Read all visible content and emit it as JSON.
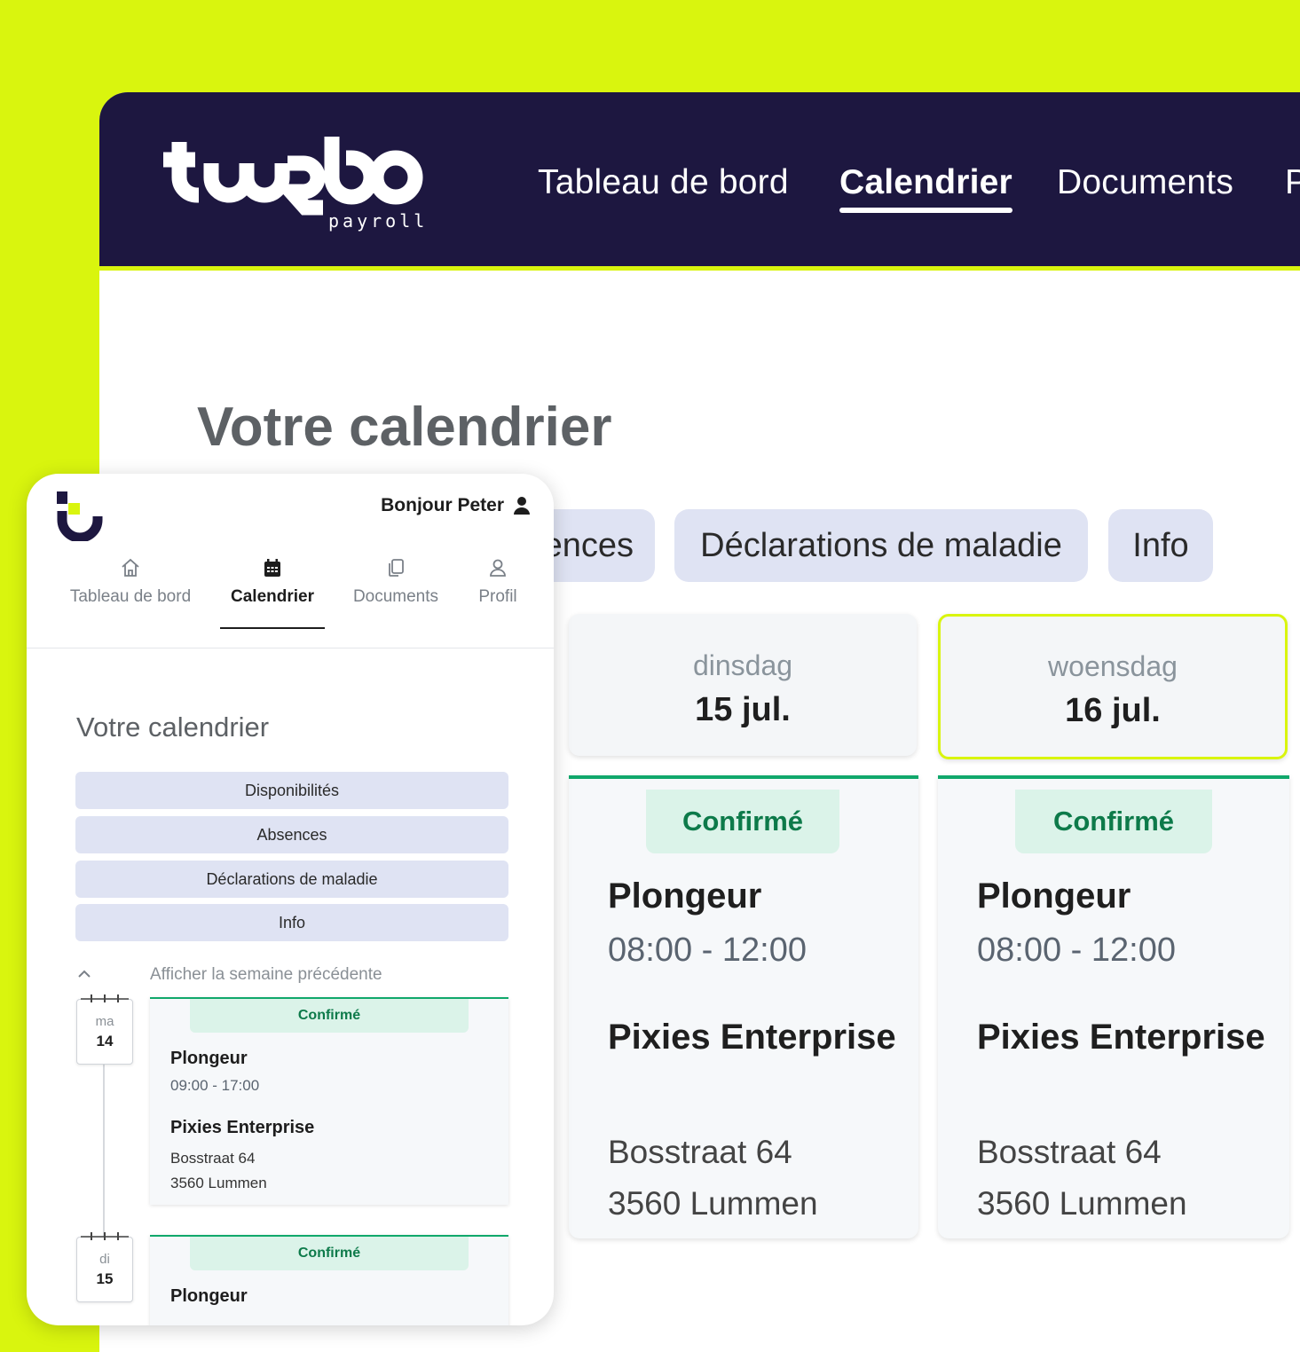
{
  "desktop": {
    "nav": {
      "logo_text": "turbo payroll",
      "items": [
        {
          "label": "Tableau de bord"
        },
        {
          "label": "Calendrier"
        },
        {
          "label": "Documents"
        },
        {
          "label": "P"
        }
      ],
      "active_index": 1
    },
    "page_title": "Votre calendrier",
    "filters": [
      {
        "label": "ences"
      },
      {
        "label": "Déclarations de maladie"
      },
      {
        "label": "Info"
      }
    ],
    "days": [
      {
        "day_name": "dinsdag",
        "date": "15 jul.",
        "today": false,
        "shift": {
          "status": "Confirmé",
          "role": "Plongeur",
          "time": "08:00 - 12:00",
          "company": "Pixies Enterprise",
          "address_line1": "Bosstraat 64",
          "address_line2": "3560 Lummen"
        }
      },
      {
        "day_name": "woensdag",
        "date": "16 jul.",
        "today": true,
        "shift": {
          "status": "Confirmé",
          "role": "Plongeur",
          "time": "08:00 - 12:00",
          "company": "Pixies Enterprise",
          "address_line1": "Bosstraat 64",
          "address_line2": "3560 Lummen"
        }
      }
    ]
  },
  "mobile": {
    "greeting": "Bonjour Peter",
    "tabs": [
      {
        "label": "Tableau de bord",
        "icon": "home-icon"
      },
      {
        "label": "Calendrier",
        "icon": "calendar-icon"
      },
      {
        "label": "Documents",
        "icon": "documents-icon"
      },
      {
        "label": "Profil",
        "icon": "user-icon"
      }
    ],
    "active_tab": 1,
    "page_title": "Votre calendrier",
    "buttons": [
      {
        "label": "Disponibilités"
      },
      {
        "label": "Absences"
      },
      {
        "label": "Déclarations de maladie"
      },
      {
        "label": "Info"
      }
    ],
    "prev_week_label": "Afficher la semaine précédente",
    "entries": [
      {
        "day_abbr": "ma",
        "day_num": "14",
        "status": "Confirmé",
        "role": "Plongeur",
        "time": "09:00 - 17:00",
        "company": "Pixies Enterprise",
        "address_line1": "Bosstraat 64",
        "address_line2": "3560 Lummen"
      },
      {
        "day_abbr": "di",
        "day_num": "15",
        "status": "Confirmé",
        "role": "Plongeur"
      }
    ]
  },
  "colors": {
    "background": "#d9f50e",
    "navbar": "#1d1740",
    "pill": "#dfe3f3",
    "confirmed_text": "#0d7a4a",
    "confirmed_bg": "#dbf3e9",
    "confirmed_border": "#10a86b"
  }
}
